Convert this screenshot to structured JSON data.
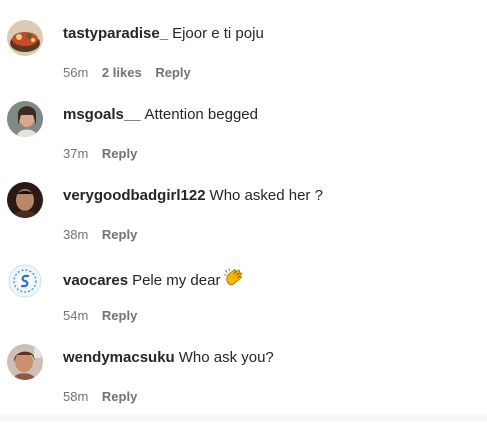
{
  "comments": [
    {
      "username": "tastyparadise_",
      "text": "Ejoor e ti poju",
      "time": "56m",
      "likes": "2 likes",
      "reply": "Reply"
    },
    {
      "username": "msgoals__",
      "text": "Attention begged",
      "time": "37m",
      "reply": "Reply"
    },
    {
      "username": "verygoodbadgirl122",
      "text": "Who asked her ?",
      "time": "38m",
      "reply": "Reply"
    },
    {
      "username": "vaocares",
      "text": "Pele my dear",
      "emoji": "clapping-hands-icon",
      "time": "54m",
      "reply": "Reply"
    },
    {
      "username": "wendymacsuku",
      "text": "Who ask you?",
      "time": "58m",
      "reply": "Reply"
    }
  ],
  "colors": {
    "text": "#262626",
    "meta": "#737373",
    "clap": "#f5b400"
  }
}
